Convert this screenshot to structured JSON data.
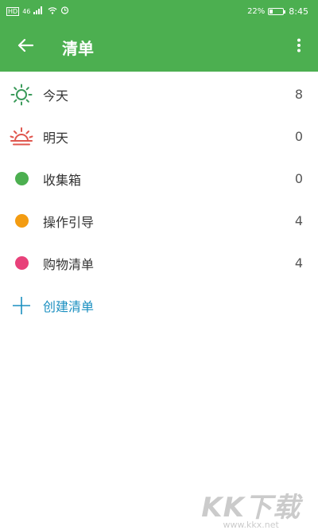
{
  "status_bar": {
    "signal_text": "46",
    "battery_percent": "22%",
    "battery_level": 0.22,
    "time": "8:45"
  },
  "app_bar": {
    "title": "清单"
  },
  "lists": [
    {
      "label": "今天",
      "count": "8",
      "icon": "sun-icon",
      "color": "#3a9a5a"
    },
    {
      "label": "明天",
      "count": "0",
      "icon": "sunrise-icon",
      "color": "#e0574f"
    },
    {
      "label": "收集箱",
      "count": "0",
      "icon": "dot",
      "color": "#4CAF50"
    },
    {
      "label": "操作引导",
      "count": "4",
      "icon": "dot",
      "color": "#F39C12"
    },
    {
      "label": "购物清单",
      "count": "4",
      "icon": "dot",
      "color": "#E8417A"
    }
  ],
  "create_list": {
    "label": "创建清单",
    "color": "#1a8fc0"
  },
  "watermark": {
    "logo": "KK下载",
    "url": "www.kkx.net"
  },
  "colors": {
    "primary": "#4CAF50",
    "accent": "#1a8fc0"
  }
}
